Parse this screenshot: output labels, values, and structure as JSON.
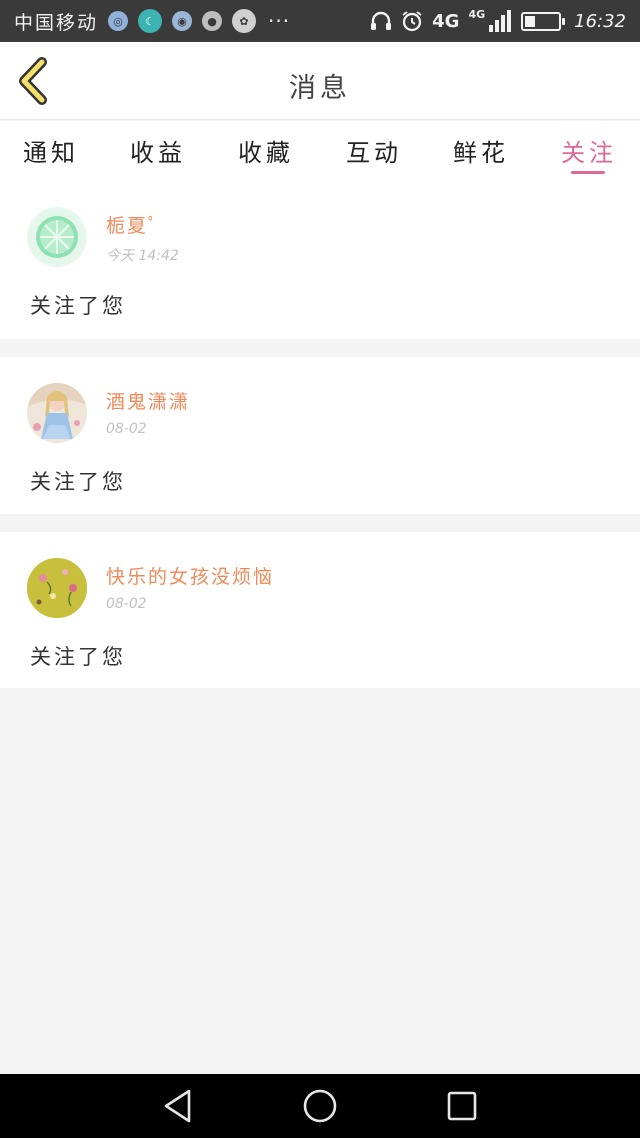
{
  "status_bar": {
    "carrier": "中国移动",
    "more": "···",
    "network": "4G",
    "network_small": "4G",
    "battery_level": 0.3,
    "time": "16:32"
  },
  "header": {
    "title": "消息"
  },
  "tabs": [
    {
      "label": "通知"
    },
    {
      "label": "收益"
    },
    {
      "label": "收藏"
    },
    {
      "label": "互动"
    },
    {
      "label": "鲜花"
    },
    {
      "label": "关注"
    }
  ],
  "active_tab": "关注",
  "accent_color": "#e06a95",
  "name_color": "#f08a5a",
  "follows": [
    {
      "name": "栀夏ﾟ",
      "time": "今天 14:42",
      "message": "关注了您"
    },
    {
      "name": "酒鬼潇潇",
      "time": "08-02",
      "message": "关注了您"
    },
    {
      "name": "快乐的女孩没烦恼",
      "time": "08-02",
      "message": "关注了您"
    }
  ],
  "nav": {
    "back": "back-triangle-icon",
    "home": "home-circle-icon",
    "recent": "recent-square-icon"
  }
}
